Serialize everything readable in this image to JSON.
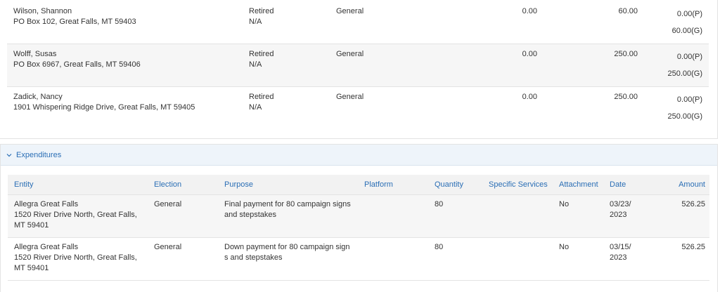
{
  "contributions": {
    "rows": [
      {
        "name": "Wilson, Shannon",
        "address": "PO Box 102, Great Falls, MT 59403",
        "occupation": "Retired",
        "employer": "N/A",
        "election": "General",
        "amount": "0.00",
        "aggregate": "60.00",
        "primary": "0.00(P)",
        "general": "60.00(G)"
      },
      {
        "name": "Wolff, Susas",
        "address": "PO Box 6967, Great Falls, MT 59406",
        "occupation": "Retired",
        "employer": "N/A",
        "election": "General",
        "amount": "0.00",
        "aggregate": "250.00",
        "primary": "0.00(P)",
        "general": "250.00(G)"
      },
      {
        "name": "Zadick, Nancy",
        "address": "1901 Whispering Ridge Drive, Great Falls, MT 59405",
        "occupation": "Retired",
        "employer": "N/A",
        "election": "General",
        "amount": "0.00",
        "aggregate": "250.00",
        "primary": "0.00(P)",
        "general": "250.00(G)"
      }
    ]
  },
  "expenditures": {
    "title": "Expenditures",
    "columns": {
      "entity": "Entity",
      "election": "Election",
      "purpose": "Purpose",
      "platform": "Platform",
      "quantity": "Quantity",
      "specific_services": "Specific Services",
      "attachment": "Attachment",
      "date": "Date",
      "amount": "Amount"
    },
    "rows": [
      {
        "entity_line1": "Allegra Great Falls",
        "entity_line2": "1520 River Drive North, Great Falls,",
        "entity_line3": "MT 59401",
        "election": "General",
        "purpose_line1": "Final payment for 80 campaign signs",
        "purpose_line2": "and stepstakes",
        "platform": "",
        "quantity": "80",
        "specific_services": "",
        "attachment": "No",
        "date_line1": "03/23/",
        "date_line2": "2023",
        "amount": "526.25"
      },
      {
        "entity_line1": "Allegra Great Falls",
        "entity_line2": "1520 River Drive North, Great Falls,",
        "entity_line3": "MT 59401",
        "election": "General",
        "purpose_line1": "Down payment for 80 campaign sign",
        "purpose_line2": "s and stepstakes",
        "platform": "",
        "quantity": "80",
        "specific_services": "",
        "attachment": "No",
        "date_line1": "03/15/",
        "date_line2": "2023",
        "amount": "526.25"
      }
    ]
  }
}
